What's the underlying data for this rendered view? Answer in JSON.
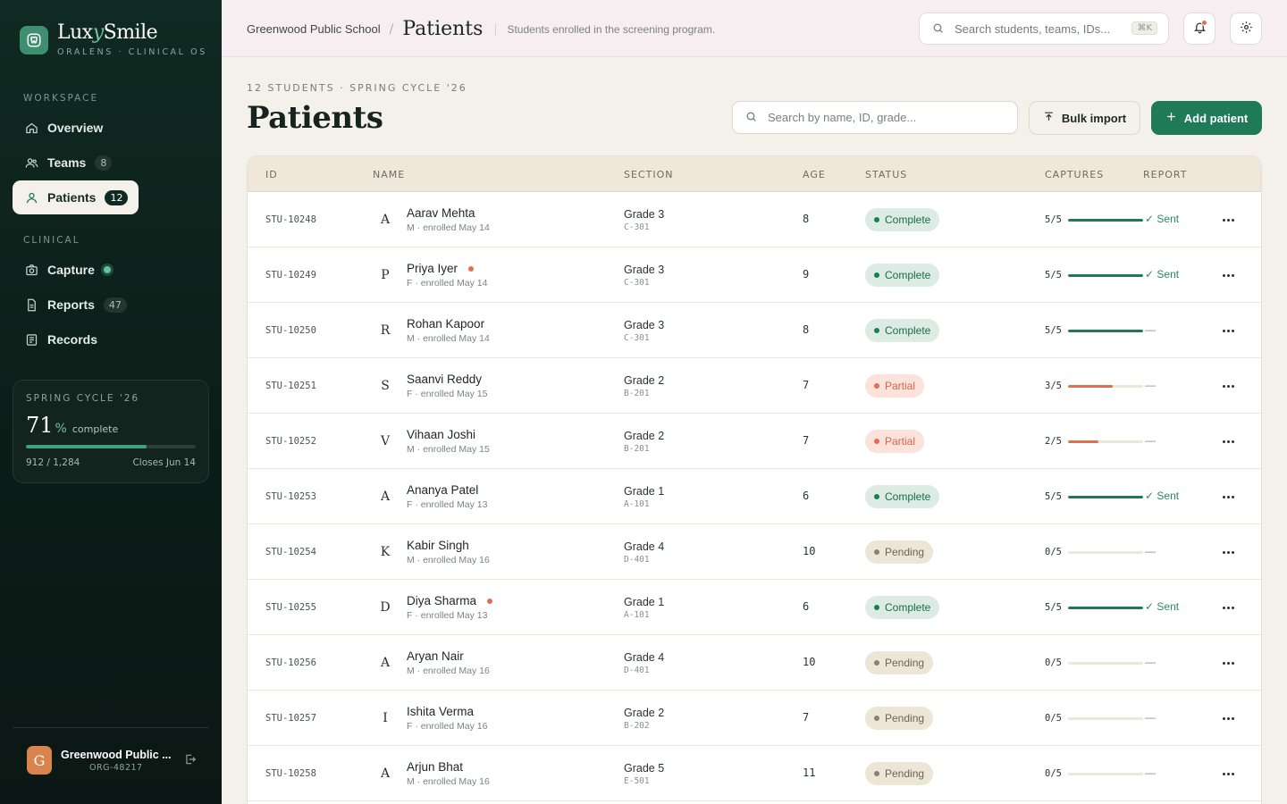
{
  "brand": {
    "name_prefix": "Lux",
    "name_italic": "y",
    "name_suffix": "Smile",
    "subtitle": "ORALENS · CLINICAL OS"
  },
  "sidebar": {
    "workspace_label": "WORKSPACE",
    "clinical_label": "CLINICAL",
    "workspace_items": [
      {
        "label": "Overview",
        "icon": "home-icon"
      },
      {
        "label": "Teams",
        "icon": "users-icon",
        "badge": "8"
      },
      {
        "label": "Patients",
        "icon": "user-icon",
        "badge": "12",
        "active": true
      }
    ],
    "clinical_items": [
      {
        "label": "Capture",
        "icon": "camera-icon",
        "status_dot": true
      },
      {
        "label": "Reports",
        "icon": "file-icon",
        "badge": "47"
      },
      {
        "label": "Records",
        "icon": "list-icon"
      }
    ],
    "cycle": {
      "title": "SPRING CYCLE '26",
      "percent": "71",
      "percent_sign": "%",
      "label": "complete",
      "progress": 0.71,
      "count": "912 / 1,284",
      "closes": "Closes Jun 14"
    },
    "org": {
      "initial": "G",
      "name": "Greenwood Public ...",
      "id": "ORG-48217"
    }
  },
  "topbar": {
    "org": "Greenwood Public School",
    "separator": "/",
    "page": "Patients",
    "description": "Students enrolled in the screening program.",
    "search_placeholder": "Search students, teams, IDs...",
    "shortcut": "⌘K"
  },
  "header": {
    "meta": "12 STUDENTS · SPRING CYCLE '26",
    "title": "Patients",
    "search_placeholder": "Search by name, ID, grade...",
    "bulk_label": "Bulk import",
    "add_label": "Add patient"
  },
  "columns": {
    "id": "ID",
    "name": "NAME",
    "section": "SECTION",
    "age": "AGE",
    "status": "STATUS",
    "captures": "CAPTURES",
    "report": "REPORT"
  },
  "colors": {
    "complete": "#1f7a58",
    "partial": "#e06e4f",
    "accent": "#1f7a58"
  },
  "patients": [
    {
      "id": "STU-10248",
      "initial": "A",
      "avatar_bg": "#f8e0d5",
      "name": "Aarav Mehta",
      "sub": "M · enrolled May 14",
      "grade": "Grade 3",
      "room": "C-301",
      "age": "8",
      "status": "Complete",
      "captures": "5/5",
      "capture_progress": 1.0,
      "report": "✓ Sent",
      "flag": false
    },
    {
      "id": "STU-10249",
      "initial": "P",
      "avatar_bg": "#f3e8cf",
      "name": "Priya Iyer",
      "sub": "F · enrolled May 14",
      "grade": "Grade 3",
      "room": "C-301",
      "age": "9",
      "status": "Complete",
      "captures": "5/5",
      "capture_progress": 1.0,
      "report": "✓ Sent",
      "flag": true
    },
    {
      "id": "STU-10250",
      "initial": "R",
      "avatar_bg": "#ebe5f3",
      "name": "Rohan Kapoor",
      "sub": "M · enrolled May 14",
      "grade": "Grade 3",
      "room": "C-301",
      "age": "8",
      "status": "Complete",
      "captures": "5/5",
      "capture_progress": 1.0,
      "report": "—",
      "flag": false
    },
    {
      "id": "STU-10251",
      "initial": "S",
      "avatar_bg": "#f5e1ea",
      "name": "Saanvi Reddy",
      "sub": "F · enrolled May 15",
      "grade": "Grade 2",
      "room": "B-201",
      "age": "7",
      "status": "Partial",
      "captures": "3/5",
      "capture_progress": 0.6,
      "report": "—",
      "flag": false
    },
    {
      "id": "STU-10252",
      "initial": "V",
      "avatar_bg": "#dcebe3",
      "name": "Vihaan Joshi",
      "sub": "M · enrolled May 15",
      "grade": "Grade 2",
      "room": "B-201",
      "age": "7",
      "status": "Partial",
      "captures": "2/5",
      "capture_progress": 0.4,
      "report": "—",
      "flag": false
    },
    {
      "id": "STU-10253",
      "initial": "A",
      "avatar_bg": "#f8e0d5",
      "name": "Ananya Patel",
      "sub": "F · enrolled May 13",
      "grade": "Grade 1",
      "room": "A-101",
      "age": "6",
      "status": "Complete",
      "captures": "5/5",
      "capture_progress": 1.0,
      "report": "✓ Sent",
      "flag": false
    },
    {
      "id": "STU-10254",
      "initial": "K",
      "avatar_bg": "#f3e8cf",
      "name": "Kabir Singh",
      "sub": "M · enrolled May 16",
      "grade": "Grade 4",
      "room": "D-401",
      "age": "10",
      "status": "Pending",
      "captures": "0/5",
      "capture_progress": 0.0,
      "report": "—",
      "flag": false
    },
    {
      "id": "STU-10255",
      "initial": "D",
      "avatar_bg": "#ebe5f3",
      "name": "Diya Sharma",
      "sub": "F · enrolled May 13",
      "grade": "Grade 1",
      "room": "A-101",
      "age": "6",
      "status": "Complete",
      "captures": "5/5",
      "capture_progress": 1.0,
      "report": "✓ Sent",
      "flag": true
    },
    {
      "id": "STU-10256",
      "initial": "A",
      "avatar_bg": "#f5e1ea",
      "name": "Aryan Nair",
      "sub": "M · enrolled May 16",
      "grade": "Grade 4",
      "room": "D-401",
      "age": "10",
      "status": "Pending",
      "captures": "0/5",
      "capture_progress": 0.0,
      "report": "—",
      "flag": false
    },
    {
      "id": "STU-10257",
      "initial": "I",
      "avatar_bg": "#dcebe3",
      "name": "Ishita Verma",
      "sub": "F · enrolled May 16",
      "grade": "Grade 2",
      "room": "B-202",
      "age": "7",
      "status": "Pending",
      "captures": "0/5",
      "capture_progress": 0.0,
      "report": "—",
      "flag": false
    },
    {
      "id": "STU-10258",
      "initial": "A",
      "avatar_bg": "#f8e0d5",
      "name": "Arjun Bhat",
      "sub": "M · enrolled May 16",
      "grade": "Grade 5",
      "room": "E-501",
      "age": "11",
      "status": "Pending",
      "captures": "0/5",
      "capture_progress": 0.0,
      "report": "—",
      "flag": false
    }
  ]
}
